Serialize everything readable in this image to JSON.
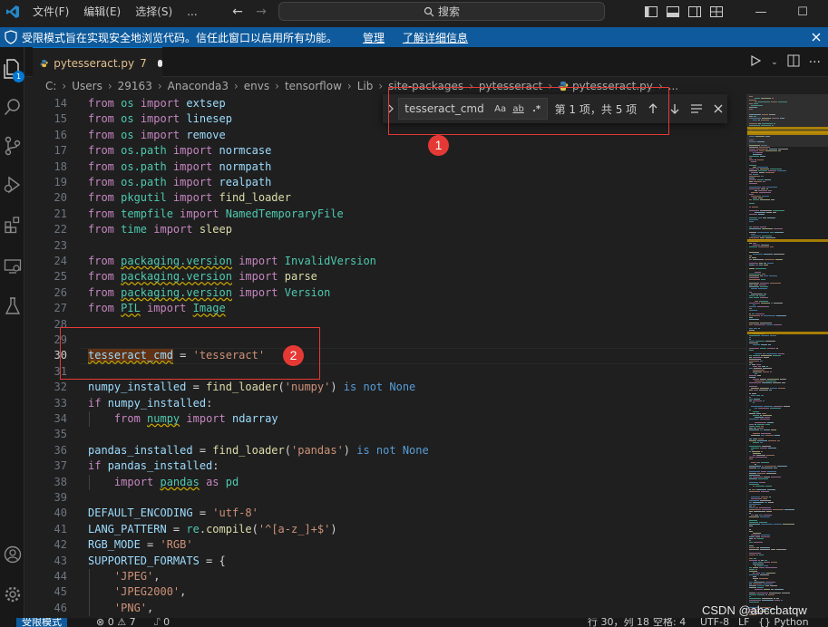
{
  "menu": [
    "文件(F)",
    "编辑(E)",
    "选择(S)",
    "..."
  ],
  "search_label": "搜索",
  "banner": {
    "text": "受限模式旨在实现安全地浏览代码。信任此窗口以启用所有功能。",
    "manage": "管理",
    "learn_more": "了解详细信息"
  },
  "activity_badge": "1",
  "tab": {
    "name": "pytesseract.py",
    "problems": "7"
  },
  "breadcrumb": [
    "C:",
    "Users",
    "29163",
    "Anaconda3",
    "envs",
    "tensorflow",
    "Lib",
    "site-packages",
    "pytesseract",
    "pytesseract.py",
    "..."
  ],
  "find": {
    "value": "tesseract_cmd",
    "match_case": "Aa",
    "whole_word": "ab",
    "regex": ".*",
    "count": "第 1 项，共 5 项"
  },
  "annotations": [
    "1",
    "2"
  ],
  "code_lines": [
    {
      "n": "14",
      "tokens": [
        [
          "kw",
          "from "
        ],
        [
          "mod",
          "os "
        ],
        [
          "kw",
          "import "
        ],
        [
          "var",
          "extsep"
        ]
      ]
    },
    {
      "n": "15",
      "tokens": [
        [
          "kw",
          "from "
        ],
        [
          "mod",
          "os "
        ],
        [
          "kw",
          "import "
        ],
        [
          "var",
          "linesep"
        ]
      ]
    },
    {
      "n": "16",
      "tokens": [
        [
          "kw",
          "from "
        ],
        [
          "mod",
          "os "
        ],
        [
          "kw",
          "import "
        ],
        [
          "var",
          "remove"
        ]
      ]
    },
    {
      "n": "17",
      "tokens": [
        [
          "kw",
          "from "
        ],
        [
          "mod",
          "os.path "
        ],
        [
          "kw",
          "import "
        ],
        [
          "var",
          "normcase"
        ]
      ]
    },
    {
      "n": "18",
      "tokens": [
        [
          "kw",
          "from "
        ],
        [
          "mod",
          "os.path "
        ],
        [
          "kw",
          "import "
        ],
        [
          "var",
          "normpath"
        ]
      ]
    },
    {
      "n": "19",
      "tokens": [
        [
          "kw",
          "from "
        ],
        [
          "mod",
          "os.path "
        ],
        [
          "kw",
          "import "
        ],
        [
          "var",
          "realpath"
        ]
      ]
    },
    {
      "n": "20",
      "tokens": [
        [
          "kw",
          "from "
        ],
        [
          "mod",
          "pkgutil "
        ],
        [
          "kw",
          "import "
        ],
        [
          "fn",
          "find_loader"
        ]
      ]
    },
    {
      "n": "21",
      "tokens": [
        [
          "kw",
          "from "
        ],
        [
          "mod",
          "tempfile "
        ],
        [
          "kw",
          "import "
        ],
        [
          "mod",
          "NamedTemporaryFile"
        ]
      ]
    },
    {
      "n": "22",
      "tokens": [
        [
          "kw",
          "from "
        ],
        [
          "mod",
          "time "
        ],
        [
          "kw",
          "import "
        ],
        [
          "fn",
          "sleep"
        ]
      ]
    },
    {
      "n": "23",
      "tokens": []
    },
    {
      "n": "24",
      "tokens": [
        [
          "kw",
          "from "
        ],
        [
          "sqmod",
          "packaging.version"
        ],
        [
          "txt",
          " "
        ],
        [
          "kw",
          "import "
        ],
        [
          "mod",
          "InvalidVersion"
        ]
      ]
    },
    {
      "n": "25",
      "tokens": [
        [
          "kw",
          "from "
        ],
        [
          "sqmod",
          "packaging.version"
        ],
        [
          "txt",
          " "
        ],
        [
          "kw",
          "import "
        ],
        [
          "fn",
          "parse"
        ]
      ]
    },
    {
      "n": "26",
      "tokens": [
        [
          "kw",
          "from "
        ],
        [
          "sqmod",
          "packaging.version"
        ],
        [
          "txt",
          " "
        ],
        [
          "kw",
          "import "
        ],
        [
          "mod",
          "Version"
        ]
      ]
    },
    {
      "n": "27",
      "tokens": [
        [
          "kw",
          "from "
        ],
        [
          "sqmod",
          "PIL"
        ],
        [
          "txt",
          " "
        ],
        [
          "kw",
          "import "
        ],
        [
          "sqmod",
          "Image"
        ]
      ]
    },
    {
      "n": "28",
      "tokens": []
    },
    {
      "n": "29",
      "tokens": []
    },
    {
      "n": "30",
      "tokens": [
        [
          "hlvar",
          "tesseract_cmd"
        ],
        [
          "txt",
          " = "
        ],
        [
          "str",
          "'tesseract'"
        ]
      ]
    },
    {
      "n": "31",
      "tokens": []
    },
    {
      "n": "32",
      "tokens": [
        [
          "var",
          "numpy_installed "
        ],
        [
          "txt",
          "= "
        ],
        [
          "fn",
          "find_loader"
        ],
        [
          "txt",
          "("
        ],
        [
          "str",
          "'numpy'"
        ],
        [
          "txt",
          ") "
        ],
        [
          "kw2",
          "is not None"
        ]
      ]
    },
    {
      "n": "33",
      "tokens": [
        [
          "kw",
          "if "
        ],
        [
          "var",
          "numpy_installed"
        ],
        [
          "txt",
          ":"
        ]
      ]
    },
    {
      "n": "34",
      "tokens": [
        [
          "txt",
          "    "
        ],
        [
          "kw",
          "from "
        ],
        [
          "sqmod",
          "numpy"
        ],
        [
          "txt",
          " "
        ],
        [
          "kw",
          "import "
        ],
        [
          "var",
          "ndarray"
        ]
      ]
    },
    {
      "n": "35",
      "tokens": []
    },
    {
      "n": "36",
      "tokens": [
        [
          "var",
          "pandas_installed "
        ],
        [
          "txt",
          "= "
        ],
        [
          "fn",
          "find_loader"
        ],
        [
          "txt",
          "("
        ],
        [
          "str",
          "'pandas'"
        ],
        [
          "txt",
          ") "
        ],
        [
          "kw2",
          "is not None"
        ]
      ]
    },
    {
      "n": "37",
      "tokens": [
        [
          "kw",
          "if "
        ],
        [
          "var",
          "pandas_installed"
        ],
        [
          "txt",
          ":"
        ]
      ]
    },
    {
      "n": "38",
      "tokens": [
        [
          "txt",
          "    "
        ],
        [
          "kw",
          "import "
        ],
        [
          "sqmod",
          "pandas"
        ],
        [
          "txt",
          " "
        ],
        [
          "kw",
          "as "
        ],
        [
          "mod",
          "pd"
        ]
      ]
    },
    {
      "n": "39",
      "tokens": []
    },
    {
      "n": "40",
      "tokens": [
        [
          "var",
          "DEFAULT_ENCODING "
        ],
        [
          "txt",
          "= "
        ],
        [
          "str",
          "'utf-8'"
        ]
      ]
    },
    {
      "n": "41",
      "tokens": [
        [
          "var",
          "LANG_PATTERN "
        ],
        [
          "txt",
          "= "
        ],
        [
          "mod",
          "re"
        ],
        [
          "txt",
          "."
        ],
        [
          "fn",
          "compile"
        ],
        [
          "txt",
          "("
        ],
        [
          "str",
          "'^[a-z_]+$'"
        ],
        [
          "txt",
          ")"
        ]
      ]
    },
    {
      "n": "42",
      "tokens": [
        [
          "var",
          "RGB_MODE "
        ],
        [
          "txt",
          "= "
        ],
        [
          "str",
          "'RGB'"
        ]
      ]
    },
    {
      "n": "43",
      "tokens": [
        [
          "var",
          "SUPPORTED_FORMATS "
        ],
        [
          "txt",
          "= {"
        ]
      ]
    },
    {
      "n": "44",
      "tokens": [
        [
          "txt",
          "    "
        ],
        [
          "str",
          "'JPEG'"
        ],
        [
          "txt",
          ","
        ]
      ]
    },
    {
      "n": "45",
      "tokens": [
        [
          "txt",
          "    "
        ],
        [
          "str",
          "'JPEG2000'"
        ],
        [
          "txt",
          ","
        ]
      ]
    },
    {
      "n": "46",
      "tokens": [
        [
          "txt",
          "    "
        ],
        [
          "str",
          "'PNG'"
        ],
        [
          "txt",
          ","
        ]
      ]
    }
  ],
  "status": {
    "restricted": "受限模式",
    "problems": "⊗ 0 ⚠ 7",
    "ports": "⑀ 0",
    "position": "行 30，列 18",
    "spaces": "空格: 4",
    "encoding": "UTF-8",
    "eol": "LF",
    "language": "{} Python"
  },
  "watermark": "CSDN @abccbatqw",
  "colors": {
    "accent": "#0078d4",
    "banner": "#0e5a9c",
    "annotation": "#e53935"
  }
}
